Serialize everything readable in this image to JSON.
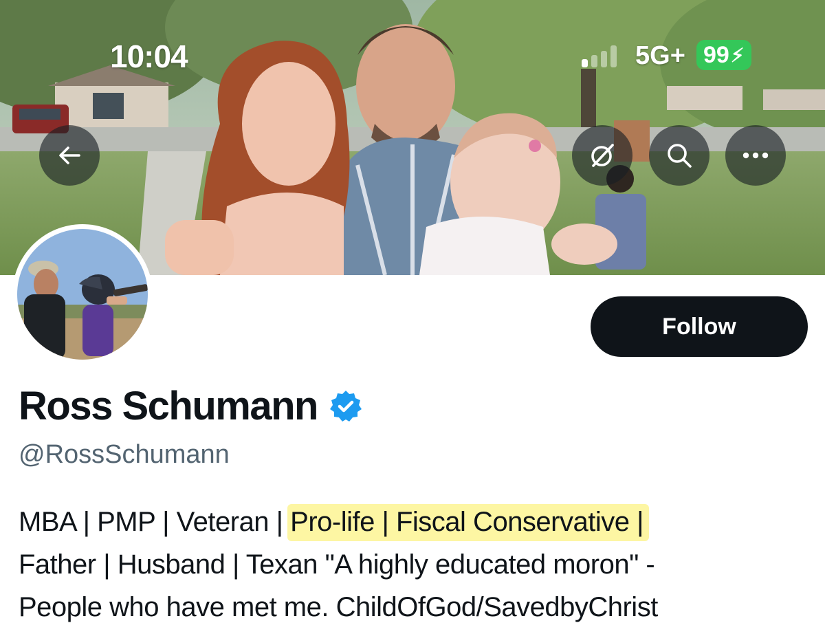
{
  "status_bar": {
    "time": "10:04",
    "network": "5G+",
    "battery": "99",
    "battery_icon": "charging-bolt-icon",
    "battery_color": "#34c759"
  },
  "header_actions": {
    "back_icon": "arrow-left-icon",
    "grok_icon": "grok-icon",
    "search_icon": "search-icon",
    "more_icon": "more-horizontal-icon"
  },
  "profile": {
    "follow_label": "Follow",
    "display_name": "Ross Schumann",
    "verified_color": "#1d9bf0",
    "handle": "@RossSchumann",
    "bio": {
      "line1_plain": "MBA | PMP | Veteran | ",
      "line1_highlight": "Pro-life | Fiscal Conservative |",
      "line2": "Father | Husband | Texan \"A highly educated moron\" -",
      "line3": "People who have met me. ChildOfGod/SavedbyChrist",
      "highlight_color": "#fdf6a3"
    }
  }
}
